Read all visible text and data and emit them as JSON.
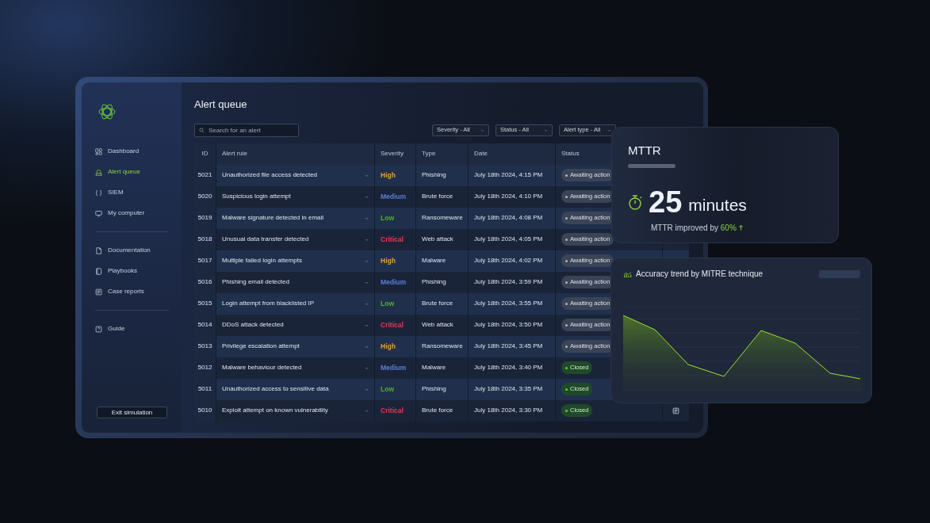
{
  "sidebar": {
    "groups": [
      [
        {
          "label": "Dashboard",
          "selected": false
        },
        {
          "label": "Alert queue",
          "selected": true
        },
        {
          "label": "SIEM",
          "selected": false
        },
        {
          "label": "My computer",
          "selected": false
        }
      ],
      [
        {
          "label": "Documentation",
          "selected": false
        },
        {
          "label": "Playbooks",
          "selected": false
        },
        {
          "label": "Case reports",
          "selected": false
        }
      ],
      [
        {
          "label": "Guide",
          "selected": false
        }
      ]
    ],
    "exit_button": "Exit simulation"
  },
  "page_title": "Alert queue",
  "search": {
    "placeholder": "Search for an alert"
  },
  "filters": [
    "Severity - All",
    "Status - All",
    "Alert type - All"
  ],
  "table": {
    "columns": [
      "ID",
      "Alert rule",
      "Severity",
      "Type",
      "Date",
      "Status"
    ],
    "rows": [
      {
        "id": "5021",
        "rule": "Unauthorized file access detected",
        "severity": "High",
        "color": "#e3a03a",
        "type": "Phishing",
        "date": "July 18th 2024, 4:15 PM",
        "status": {
          "label": "Awaiting action",
          "kind": "awaiting"
        }
      },
      {
        "id": "5020",
        "rule": "Suspicious login attempt",
        "severity": "Medium",
        "color": "#5a7fd8",
        "type": "Brute force",
        "date": "July 18th 2024, 4:10 PM",
        "status": {
          "label": "Awaiting action",
          "kind": "awaiting"
        }
      },
      {
        "id": "5019",
        "rule": "Malware signature detected in email",
        "severity": "Low",
        "color": "#4fae36",
        "type": "Ransomeware",
        "date": "July 18th 2024, 4:08 PM",
        "status": {
          "label": "Awaiting action",
          "kind": "awaiting"
        }
      },
      {
        "id": "5018",
        "rule": "Unusual data transfer detected",
        "severity": "Critical",
        "color": "#e23c52",
        "type": "Web attack",
        "date": "July 18th 2024, 4:05 PM",
        "status": {
          "label": "Awaiting action",
          "kind": "awaiting"
        }
      },
      {
        "id": "5017",
        "rule": "Multiple failed login attempts",
        "severity": "High",
        "color": "#e3a03a",
        "type": "Malware",
        "date": "July 18th 2024, 4:02 PM",
        "status": {
          "label": "Awaiting action",
          "kind": "awaiting"
        }
      },
      {
        "id": "5016",
        "rule": "Phishing email detected",
        "severity": "Medium",
        "color": "#5a7fd8",
        "type": "Phishing",
        "date": "July 18th 2024, 3:59 PM",
        "status": {
          "label": "Awaiting action",
          "kind": "awaiting"
        }
      },
      {
        "id": "5015",
        "rule": "Login attempt from blacklisted IP",
        "severity": "Low",
        "color": "#4fae36",
        "type": "Brute force",
        "date": "July 18th 2024, 3:55 PM",
        "status": {
          "label": "Awaiting action",
          "kind": "awaiting"
        }
      },
      {
        "id": "5014",
        "rule": "DDoS attack detected",
        "severity": "Critical",
        "color": "#e23c52",
        "type": "Web attack",
        "date": "July 18th 2024, 3:50 PM",
        "status": {
          "label": "Awaiting action",
          "kind": "awaiting"
        }
      },
      {
        "id": "5013",
        "rule": "Privilege escalation attempt",
        "severity": "High",
        "color": "#e3a03a",
        "type": "Ransomeware",
        "date": "July 18th 2024, 3:45 PM",
        "status": {
          "label": "Awaiting action",
          "kind": "awaiting"
        }
      },
      {
        "id": "5012",
        "rule": "Malware behaviour detected",
        "severity": "Medium",
        "color": "#5a7fd8",
        "type": "Malware",
        "date": "July 18th 2024, 3:40 PM",
        "status": {
          "label": "Closed",
          "kind": "closed"
        }
      },
      {
        "id": "5011",
        "rule": "Unauthorized access to sensitive data",
        "severity": "Low",
        "color": "#4fae36",
        "type": "Phishing",
        "date": "July 18th 2024, 3:35 PM",
        "status": {
          "label": "Closed",
          "kind": "closed"
        }
      },
      {
        "id": "5010",
        "rule": "Exploit attempt on known vulnerability",
        "severity": "Critical",
        "color": "#e23c52",
        "type": "Brute force",
        "date": "July 18th 2024, 3:30 PM",
        "status": {
          "label": "Closed",
          "kind": "closed"
        },
        "report_icon": true
      }
    ]
  },
  "mttr_card": {
    "title": "MTTR",
    "value": "25",
    "unit": "minutes",
    "improvement_text": "MTTR improved by",
    "improvement_value": "60%"
  },
  "accuracy_card": {
    "title": "Accuracy trend by MITRE technique"
  }
}
